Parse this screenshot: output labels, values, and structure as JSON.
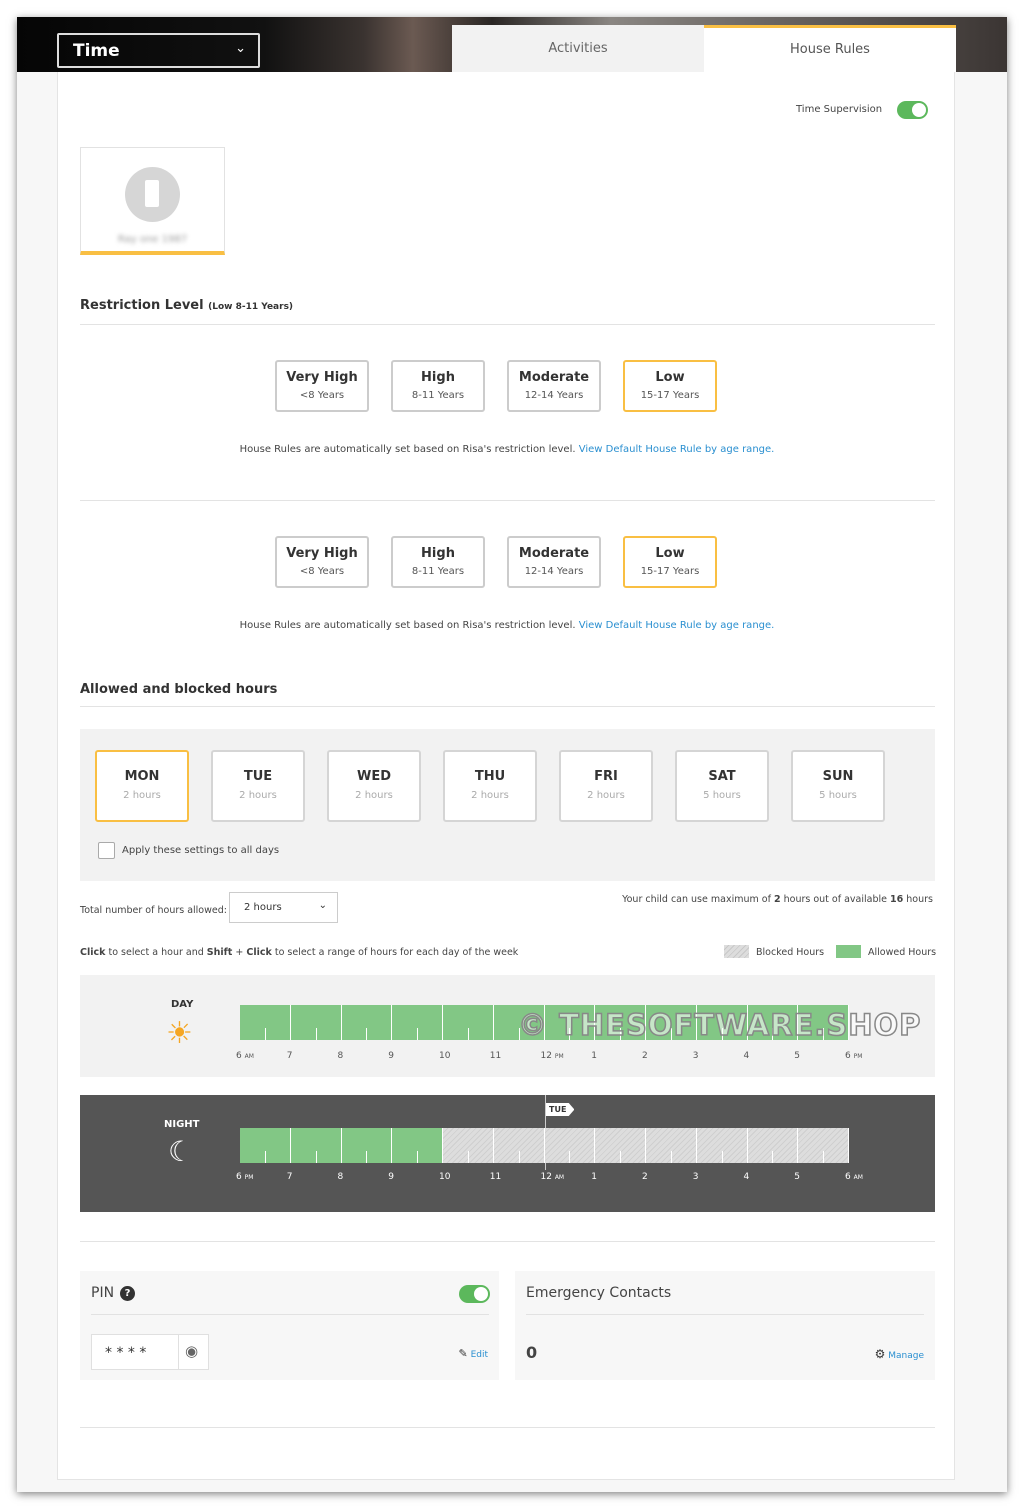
{
  "header": {
    "module_select": "Time",
    "tabs": [
      {
        "label": "Activities",
        "active": false
      },
      {
        "label": "House Rules",
        "active": true
      }
    ]
  },
  "supervision": {
    "label": "Time Supervision",
    "enabled": true
  },
  "device": {
    "name": "Ray one 1987",
    "icon": "android-phone-icon"
  },
  "restriction_sections": [
    {
      "title": "Restriction Level",
      "subtitle": "(Low 8-11 Years)",
      "levels": [
        {
          "name": "Very High",
          "range": "<8 Years"
        },
        {
          "name": "High",
          "range": "8-11 Years"
        },
        {
          "name": "Moderate",
          "range": "12-14 Years"
        },
        {
          "name": "Low",
          "range": "15-17 Years",
          "selected": true
        }
      ],
      "note": "House Rules are automatically set based on Risa's restriction level.",
      "note_link": "View Default House Rule by age range."
    },
    {
      "title": "Restriction Level",
      "subtitle": "(Low 8-11 Years)",
      "levels": [
        {
          "name": "Very High",
          "range": "<8 Years"
        },
        {
          "name": "High",
          "range": "8-11 Years"
        },
        {
          "name": "Moderate",
          "range": "12-14 Years"
        },
        {
          "name": "Low",
          "range": "15-17 Years",
          "selected": true
        }
      ],
      "note": "House Rules are automatically set based on Risa's restriction level.",
      "note_link": "View Default House Rule by age range."
    }
  ],
  "hours": {
    "title": "Allowed and blocked hours",
    "days": [
      {
        "d": "MON",
        "h": "2 hours",
        "selected": true
      },
      {
        "d": "TUE",
        "h": "2 hours"
      },
      {
        "d": "WED",
        "h": "2 hours"
      },
      {
        "d": "THU",
        "h": "2 hours"
      },
      {
        "d": "FRI",
        "h": "2 hours"
      },
      {
        "d": "SAT",
        "h": "5 hours"
      },
      {
        "d": "SUN",
        "h": "5 hours"
      }
    ],
    "apply_all": "Apply these settings to all days",
    "total_label": "Total number of hours allowed:",
    "total_value": "2 hours",
    "summary_pre": "Your child can use maximum of",
    "summary_used": "2",
    "summary_mid": "hours out of available",
    "summary_avail": "16",
    "summary_post": "hours",
    "instr_click": "Click",
    "instr_1": "to select a hour and",
    "instr_shift": "Shift",
    "instr_plus": "+",
    "instr_click2": "Click",
    "instr_2": "to select a range of hours for each day of the week",
    "legend_blocked": "Blocked Hours",
    "legend_allowed": "Allowed Hours",
    "day": {
      "label": "DAY",
      "ticks": [
        [
          "6",
          "AM"
        ],
        [
          "7",
          ""
        ],
        [
          "8",
          ""
        ],
        [
          "9",
          ""
        ],
        [
          "10",
          ""
        ],
        [
          "11",
          ""
        ],
        [
          "12",
          "PM"
        ],
        [
          "1",
          ""
        ],
        [
          "2",
          ""
        ],
        [
          "3",
          ""
        ],
        [
          "4",
          ""
        ],
        [
          "5",
          ""
        ],
        [
          "6",
          "PM"
        ]
      ],
      "allowed": [
        1,
        1,
        1,
        1,
        1,
        1,
        1,
        1,
        1,
        1,
        1,
        1
      ]
    },
    "night": {
      "label": "NIGHT",
      "marker": "TUE",
      "ticks": [
        [
          "6",
          "PM"
        ],
        [
          "7",
          ""
        ],
        [
          "8",
          ""
        ],
        [
          "9",
          ""
        ],
        [
          "10",
          ""
        ],
        [
          "11",
          ""
        ],
        [
          "12",
          "AM"
        ],
        [
          "1",
          ""
        ],
        [
          "2",
          ""
        ],
        [
          "3",
          ""
        ],
        [
          "4",
          ""
        ],
        [
          "5",
          ""
        ],
        [
          "6",
          "AM"
        ]
      ],
      "allowed": [
        1,
        1,
        1,
        1,
        0,
        0,
        0,
        0,
        0,
        0,
        0,
        0
      ]
    }
  },
  "pin": {
    "label": "PIN",
    "enabled": true,
    "value": "* * * *",
    "edit": "Edit"
  },
  "emergency": {
    "label": "Emergency Contacts",
    "count": "0",
    "manage": "Manage"
  },
  "watermark": "© THESOFTWARE.SHOP",
  "colors": {
    "accent": "#f9bf43",
    "allowed": "#82c785",
    "toggle": "#5cb85c",
    "link": "#2a8fd0"
  }
}
